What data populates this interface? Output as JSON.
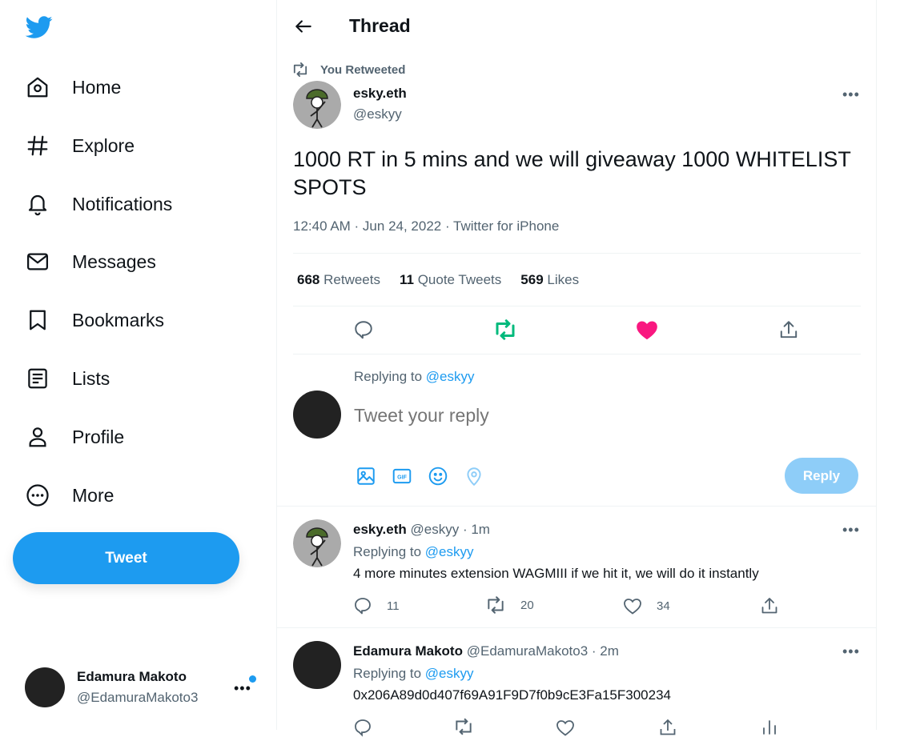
{
  "colors": {
    "brand": "#1d9bf0",
    "retweet": "#00ba7c",
    "like": "#f91880",
    "text": "#0f1419",
    "muted": "#536471"
  },
  "sidebar": {
    "logo_icon": "twitter-bird-icon",
    "items": [
      {
        "label": "Home",
        "icon": "home-icon"
      },
      {
        "label": "Explore",
        "icon": "hashtag-icon"
      },
      {
        "label": "Notifications",
        "icon": "bell-icon"
      },
      {
        "label": "Messages",
        "icon": "envelope-icon"
      },
      {
        "label": "Bookmarks",
        "icon": "bookmark-icon"
      },
      {
        "label": "Lists",
        "icon": "list-icon"
      },
      {
        "label": "Profile",
        "icon": "person-icon"
      },
      {
        "label": "More",
        "icon": "more-circle-icon"
      }
    ],
    "tweet_button": "Tweet",
    "account": {
      "name": "Edamura Makoto",
      "handle": "@EdamuraMakoto3"
    }
  },
  "header": {
    "title": "Thread"
  },
  "main_tweet": {
    "retweet_label": "You Retweeted",
    "author_name": "esky.eth",
    "author_handle": "@eskyy",
    "text": "1000 RT in 5 mins and we will giveaway 1000 WHITELIST SPOTS",
    "meta": "12:40 AM · Jun 24, 2022 · Twitter for iPhone",
    "stats": {
      "retweets_count": "668",
      "retweets_label": "Retweets",
      "quotes_count": "11",
      "quotes_label": "Quote Tweets",
      "likes_count": "569",
      "likes_label": "Likes"
    }
  },
  "composer": {
    "replying_prefix": "Replying to ",
    "replying_handle": "@eskyy",
    "placeholder": "Tweet your reply",
    "reply_button": "Reply"
  },
  "replies": [
    {
      "author_name": "esky.eth",
      "author_handle": "@eskyy",
      "time": "· 1m",
      "replying_prefix": "Replying to ",
      "replying_handle": "@eskyy",
      "text": "4 more minutes extension WAGMIII if we hit it, we will do it instantly",
      "reply_count": "11",
      "retweet_count": "20",
      "like_count": "34"
    },
    {
      "author_name": "Edamura Makoto",
      "author_handle": "@EdamuraMakoto3",
      "time": "· 2m",
      "replying_prefix": "Replying to ",
      "replying_handle": "@eskyy",
      "text": "0x206A89d0d407f69A91F9D7f0b9cE3Fa15F300234"
    }
  ]
}
